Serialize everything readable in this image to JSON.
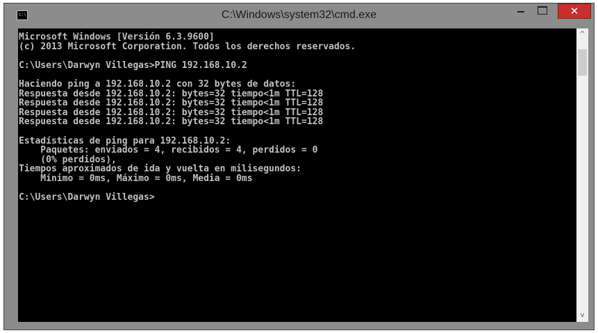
{
  "window": {
    "title": "C:\\Windows\\system32\\cmd.exe",
    "icon_label": "C:\\",
    "controls": {
      "minimize": "minimize-icon",
      "maximize": "maximize-icon",
      "close": "✕"
    }
  },
  "console": {
    "lines": [
      "Microsoft Windows [Versión 6.3.9600]",
      "(c) 2013 Microsoft Corporation. Todos los derechos reservados.",
      "",
      "C:\\Users\\Darwyn Villegas>PING 192.168.10.2",
      "",
      "Haciendo ping a 192.168.10.2 con 32 bytes de datos:",
      "Respuesta desde 192.168.10.2: bytes=32 tiempo<1m TTL=128",
      "Respuesta desde 192.168.10.2: bytes=32 tiempo<1m TTL=128",
      "Respuesta desde 192.168.10.2: bytes=32 tiempo<1m TTL=128",
      "Respuesta desde 192.168.10.2: bytes=32 tiempo<1m TTL=128",
      "",
      "Estadísticas de ping para 192.168.10.2:",
      "    Paquetes: enviados = 4, recibidos = 4, perdidos = 0",
      "    (0% perdidos),",
      "Tiempos aproximados de ida y vuelta en milisegundos:",
      "    Mínimo = 0ms, Máximo = 0ms, Media = 0ms",
      "",
      "C:\\Users\\Darwyn Villegas>"
    ]
  },
  "scrollbar": {
    "up_arrow": "^",
    "down_arrow": "v"
  },
  "colors": {
    "frame": "#8c8c8c",
    "console_bg": "#000000",
    "console_text": "#c0c0c0",
    "close": "#c8302c"
  }
}
